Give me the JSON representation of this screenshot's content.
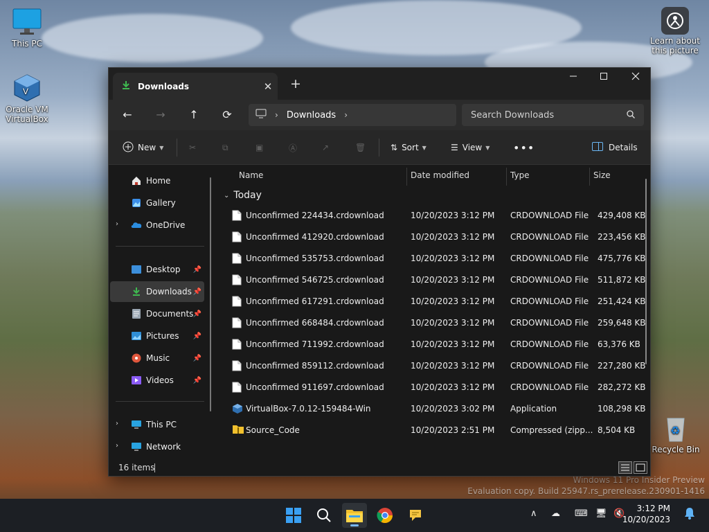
{
  "desktop": {
    "icons": [
      {
        "label": "This PC"
      },
      {
        "label": "Oracle VM VirtualBox"
      },
      {
        "label": "Learn about this picture"
      },
      {
        "label": "Recycle Bin"
      }
    ],
    "watermark_line1": "Windows 11 Pro Insider Preview",
    "watermark_line2": "Evaluation copy. Build 25947.rs_prerelease.230901-1416"
  },
  "window": {
    "tab_title": "Downloads",
    "address": {
      "root_icon": "monitor-icon",
      "crumb": "Downloads"
    },
    "search_placeholder": "Search Downloads",
    "toolbar": {
      "new_label": "New",
      "sort_label": "Sort",
      "view_label": "View",
      "details_label": "Details"
    },
    "sidebar": {
      "top": [
        "Home",
        "Gallery",
        "OneDrive"
      ],
      "pinned": [
        "Desktop",
        "Downloads",
        "Documents",
        "Pictures",
        "Music",
        "Videos"
      ],
      "bottom": [
        "This PC",
        "Network"
      ],
      "active": "Downloads"
    },
    "columns": {
      "name": "Name",
      "date": "Date modified",
      "type": "Type",
      "size": "Size"
    },
    "group_label": "Today",
    "files": [
      {
        "name": "Unconfirmed 224434.crdownload",
        "date": "10/20/2023 3:12 PM",
        "type": "CRDOWNLOAD File",
        "size": "429,408 KB",
        "icon": "file-icon"
      },
      {
        "name": "Unconfirmed 412920.crdownload",
        "date": "10/20/2023 3:12 PM",
        "type": "CRDOWNLOAD File",
        "size": "223,456 KB",
        "icon": "file-icon"
      },
      {
        "name": "Unconfirmed 535753.crdownload",
        "date": "10/20/2023 3:12 PM",
        "type": "CRDOWNLOAD File",
        "size": "475,776 KB",
        "icon": "file-icon"
      },
      {
        "name": "Unconfirmed 546725.crdownload",
        "date": "10/20/2023 3:12 PM",
        "type": "CRDOWNLOAD File",
        "size": "511,872 KB",
        "icon": "file-icon"
      },
      {
        "name": "Unconfirmed 617291.crdownload",
        "date": "10/20/2023 3:12 PM",
        "type": "CRDOWNLOAD File",
        "size": "251,424 KB",
        "icon": "file-icon"
      },
      {
        "name": "Unconfirmed 668484.crdownload",
        "date": "10/20/2023 3:12 PM",
        "type": "CRDOWNLOAD File",
        "size": "259,648 KB",
        "icon": "file-icon"
      },
      {
        "name": "Unconfirmed 711992.crdownload",
        "date": "10/20/2023 3:12 PM",
        "type": "CRDOWNLOAD File",
        "size": "63,376 KB",
        "icon": "file-icon"
      },
      {
        "name": "Unconfirmed 859112.crdownload",
        "date": "10/20/2023 3:12 PM",
        "type": "CRDOWNLOAD File",
        "size": "227,280 KB",
        "icon": "file-icon"
      },
      {
        "name": "Unconfirmed 911697.crdownload",
        "date": "10/20/2023 3:12 PM",
        "type": "CRDOWNLOAD File",
        "size": "282,272 KB",
        "icon": "file-icon"
      },
      {
        "name": "VirtualBox-7.0.12-159484-Win",
        "date": "10/20/2023 3:02 PM",
        "type": "Application",
        "size": "108,298 KB",
        "icon": "virtualbox-app-icon"
      },
      {
        "name": "Source_Code",
        "date": "10/20/2023 2:51 PM",
        "type": "Compressed (zipp...",
        "size": "8,504 KB",
        "icon": "zip-folder-icon"
      }
    ],
    "status_text": "16 items"
  },
  "taskbar": {
    "apps": [
      "start-icon",
      "search-icon",
      "file-explorer-icon",
      "chrome-icon",
      "feedback-hub-icon"
    ],
    "active_app": "file-explorer-icon",
    "time": "3:12 PM",
    "date": "10/20/2023"
  }
}
